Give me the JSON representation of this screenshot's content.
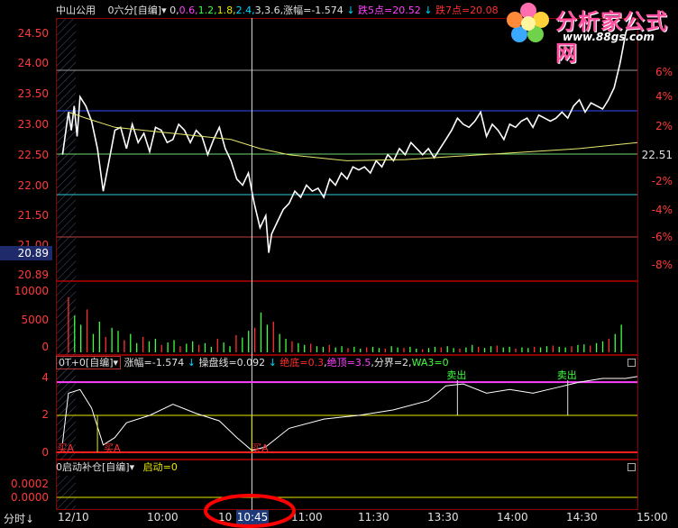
{
  "header": {
    "stock_name": "中山公用",
    "ma_selector": "0六分[自编]",
    "ma_values": [
      "0,",
      "0.6,",
      "1.2,",
      "1.8,",
      "2.4,",
      "3,",
      "3.6,"
    ],
    "change_label": "涨幅=-1.574",
    "limit_down5": "跌5点=20.52",
    "limit_down7": "跌7点=20.08"
  },
  "main_axis": {
    "price_ticks": [
      "24.50",
      "24.00",
      "23.50",
      "23.00",
      "22.50",
      "22.00",
      "21.50",
      "21.00"
    ],
    "pct_ticks": [
      "6%",
      "4%",
      "2%",
      "22.51",
      "-2%",
      "-4%",
      "-6%",
      "-8%"
    ],
    "cursor_price": "20.89",
    "low_price": "20.89"
  },
  "volume_axis": {
    "ticks": [
      "10000",
      "5000",
      "0"
    ]
  },
  "indicator": {
    "selector": "0T+0[自编]",
    "change_label": "涨幅=-1.574",
    "line_label": "操盘线=0.092",
    "bottom_label": "绝底=0.3",
    "top_label": "绝顶=3.5",
    "divide_label": "分界=2,",
    "wa3_label": "WA3=0",
    "ticks": [
      "4",
      "2",
      "0"
    ],
    "buy_labels": [
      "买A",
      "买A",
      "买A"
    ],
    "sell_labels": [
      "卖出",
      "卖出"
    ]
  },
  "bottom_indicator": {
    "selector": "0启动补仓[自编]",
    "start_label": "启动=0",
    "ticks": [
      "0.0002",
      "0.0000"
    ]
  },
  "time_axis": {
    "mode_label": "分时",
    "labels": [
      "12/10",
      "10:00",
      "10",
      "11:00",
      "11:30",
      "13:30",
      "14:00",
      "14:30",
      "15:00"
    ],
    "cursor_time": "10:45"
  },
  "logo": {
    "title": "分析家公式网",
    "url": "www.88gs.com"
  },
  "colors": {
    "background": "#000000",
    "border": "#8b0000",
    "price_line": "#ffffff",
    "avg_line": "#e8e870",
    "volume_bar": "#ff3030",
    "volume_bar_alt": "#40ff40",
    "indicator_top": "#ff40ff",
    "indicator_mid": "#e8e800",
    "indicator_bottom": "#ff2020",
    "highlight_circle": "#ff0000"
  }
}
